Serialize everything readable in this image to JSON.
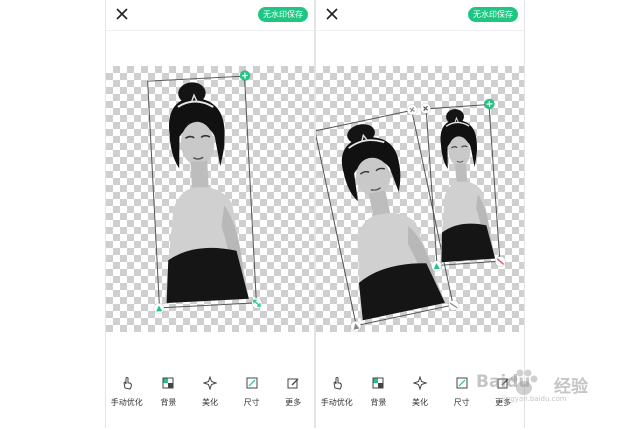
{
  "screens": [
    {
      "save_label": "无水印保存",
      "toolbar": [
        {
          "icon": "hand-pointer-icon",
          "label": "手动优化"
        },
        {
          "icon": "background-icon",
          "label": "背景"
        },
        {
          "icon": "sparkle-icon",
          "label": "美化"
        },
        {
          "icon": "crop-size-icon",
          "label": "尺寸"
        },
        {
          "icon": "edit-more-icon",
          "label": "更多"
        }
      ]
    },
    {
      "save_label": "无水印保存",
      "toolbar": [
        {
          "icon": "hand-pointer-icon",
          "label": "手动优化"
        },
        {
          "icon": "background-icon",
          "label": "背景"
        },
        {
          "icon": "sparkle-icon",
          "label": "美化"
        },
        {
          "icon": "crop-size-icon",
          "label": "尺寸"
        },
        {
          "icon": "edit-more-icon",
          "label": "更多"
        }
      ]
    }
  ],
  "watermark": {
    "brand": "Baidu",
    "suffix": "经验",
    "url": "jingyan.baidu.com"
  },
  "colors": {
    "accent": "#1ec684",
    "checker": "#cfcfcf",
    "text": "#333333"
  }
}
